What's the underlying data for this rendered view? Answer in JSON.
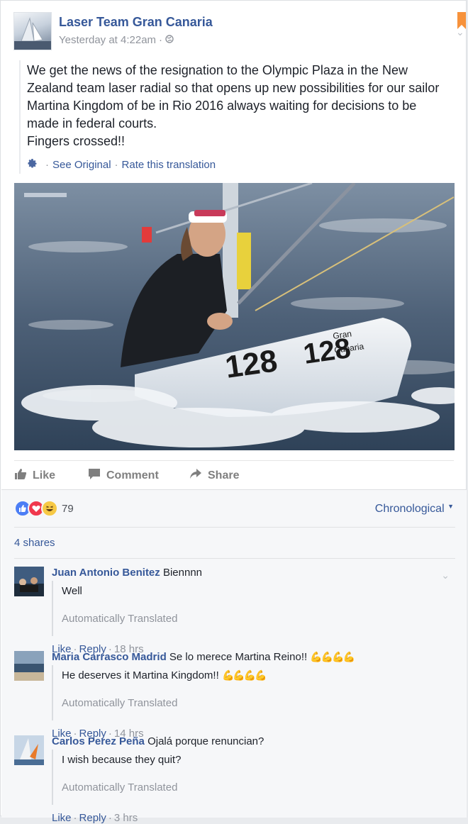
{
  "post": {
    "page_name": "Laser Team Gran Canaria",
    "timestamp": "Yesterday at 4:22am",
    "privacy_icon": "globe-icon",
    "text_lines": [
      "We get the news of the resignation to the Olympic Plaza in the New",
      "Zealand team laser radial so that opens up new possibilities for our sailor",
      "Martina Kingdom of be in Rio 2016 always waiting for decisions to be",
      "made in federal courts.",
      "Fingers crossed!!"
    ],
    "see_original": "See Original",
    "rate_translation": "Rate this translation",
    "photo_labels": {
      "sail_number": "128",
      "boat_text_1": "Gran",
      "boat_text_2": "Canaria"
    }
  },
  "actions": {
    "like": "Like",
    "comment": "Comment",
    "share": "Share"
  },
  "reactions": {
    "count": "79",
    "order": "Chronological"
  },
  "shares": "4 shares",
  "comments": [
    {
      "name": "Juan Antonio Benitez",
      "original": "Biennnn",
      "translation": "Well",
      "auto_label": "Automatically Translated",
      "like": "Like",
      "reply": "Reply",
      "time": "18 hrs"
    },
    {
      "name": "Maria Carrasco Madrid",
      "original": "Se lo merece Martina Reino!!",
      "emoji": "💪💪💪💪",
      "translation": "He deserves it Martina Kingdom!!",
      "auto_label": "Automatically Translated",
      "like": "Like",
      "reply": "Reply",
      "time": "14 hrs"
    },
    {
      "name": "Carlos Perez Peña",
      "original": "Ojalá porque renuncian?",
      "translation": "I wish because they quit?",
      "auto_label": "Automatically Translated",
      "like": "Like",
      "reply": "Reply",
      "time": "3 hrs"
    }
  ]
}
